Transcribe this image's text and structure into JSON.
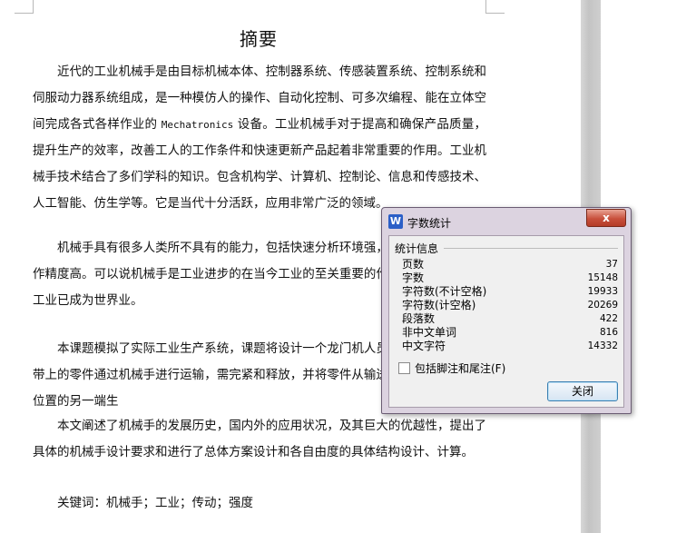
{
  "document": {
    "title": "摘要",
    "p1_a": "近代的工业机械手是由目标机械本体、控制器系统、传感装置系统、控制系统和伺服动力器系统组成，是一种模仿人的操作、自动化控制、可多次编程、能在立体空间完成各式各样作业的 ",
    "p1_mono": "Mechatronics",
    "p1_b": " 设备。工业机械手对于提高和确保产品质量，提升生产的效率，改善工人的工作条件和快速更新产品起着非常重要的作用。工业机械手技术结合了多们学科的知识。包含机构学、计算机、控制论、信息和传感技术、人工智能、仿生学等。它是当代十分活跃，应用非常广泛的领域。",
    "p2": "机械手具有很多人类所不具有的能力，包括快速分析环境强，能长时间工作和工作精度高。可以说机械手是工业进步的在当今工业的至关重要的作用。如今，机械手工业已成为世界业。",
    "p3": "本课题模拟了实际工业生产系统，课题将设计一个龙门机人员出入，使断开输送带上的零件通过机械手进行运输，需完紧和释放，并将零件从输送带的一端送到指定位置的另一端生",
    "p4": "本文阐述了机械手的发展历史，国内外的应用状况，及其巨大的优越性，提出了具体的机械手设计要求和进行了总体方案设计和各自由度的具体结构设计、计算。",
    "p5": "关键词：机械手；工业；传动；强度"
  },
  "dialog": {
    "title": "字数统计",
    "app_icon": "W",
    "close_x": "x",
    "group_label": "统计信息",
    "stats": [
      {
        "label": "页数",
        "value": "37"
      },
      {
        "label": "字数",
        "value": "15148"
      },
      {
        "label": "字符数(不计空格)",
        "value": "19933"
      },
      {
        "label": "字符数(计空格)",
        "value": "20269"
      },
      {
        "label": "段落数",
        "value": "422"
      },
      {
        "label": "非中文单词",
        "value": "816"
      },
      {
        "label": "中文字符",
        "value": "14332"
      }
    ],
    "checkbox_label": "包括脚注和尾注(F)",
    "close_button": "关闭"
  }
}
